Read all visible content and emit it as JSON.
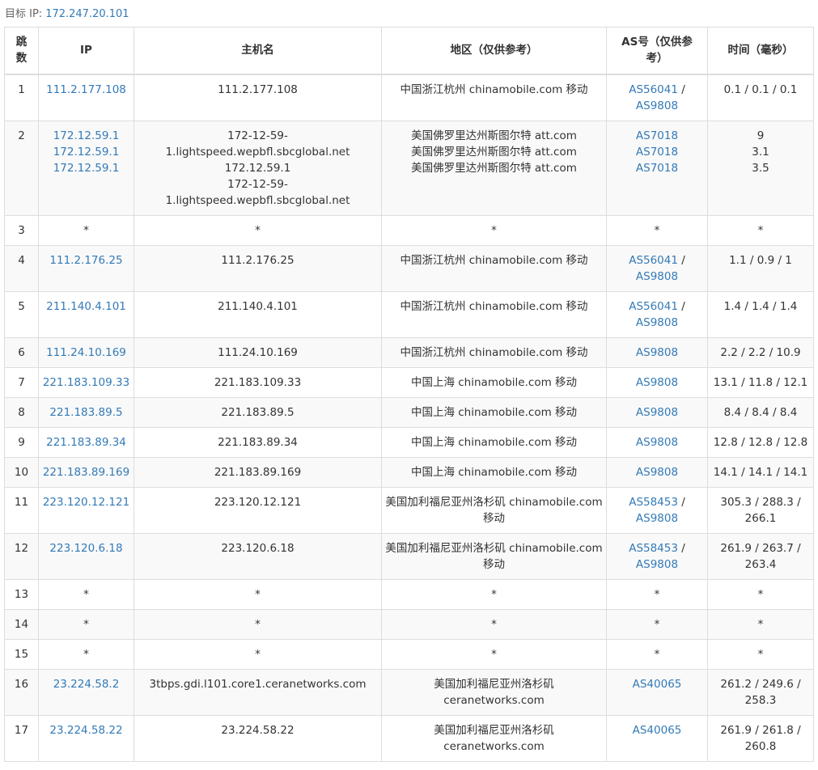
{
  "target": {
    "label": "目标 IP:",
    "ip": "172.247.20.101"
  },
  "colors": {
    "link": "#337ab7",
    "text": "#333333",
    "border": "#dddddd",
    "zebra": "#f9f9f9"
  },
  "table": {
    "headers": {
      "hop": "跳数",
      "ip": "IP",
      "hostname": "主机名",
      "region": "地区（仅供参考）",
      "as": "AS号（仅供参考）",
      "time": "时间（毫秒）"
    },
    "rows": [
      {
        "hop": "1",
        "ips": [
          "111.2.177.108"
        ],
        "hosts": [
          "111.2.177.108"
        ],
        "regions": [
          "中国浙江杭州 chinamobile.com 移动"
        ],
        "as": [
          [
            "AS56041",
            "AS9808"
          ]
        ],
        "times": [
          "0.1 / 0.1 / 0.1"
        ]
      },
      {
        "hop": "2",
        "ips": [
          "172.12.59.1",
          "172.12.59.1",
          "172.12.59.1"
        ],
        "hosts": [
          "172-12-59-1.lightspeed.wepbfl.sbcglobal.net",
          "172.12.59.1",
          "172-12-59-1.lightspeed.wepbfl.sbcglobal.net"
        ],
        "regions": [
          "美国佛罗里达州斯图尔特 att.com",
          "美国佛罗里达州斯图尔特 att.com",
          "美国佛罗里达州斯图尔特 att.com"
        ],
        "as": [
          [
            "AS7018"
          ],
          [
            "AS7018"
          ],
          [
            "AS7018"
          ]
        ],
        "times": [
          "9",
          "3.1",
          "3.5"
        ]
      },
      {
        "hop": "3",
        "ips": [
          "*"
        ],
        "hosts": [
          "*"
        ],
        "regions": [
          "*"
        ],
        "as": [
          [
            "*"
          ]
        ],
        "times": [
          "*"
        ]
      },
      {
        "hop": "4",
        "ips": [
          "111.2.176.25"
        ],
        "hosts": [
          "111.2.176.25"
        ],
        "regions": [
          "中国浙江杭州 chinamobile.com 移动"
        ],
        "as": [
          [
            "AS56041",
            "AS9808"
          ]
        ],
        "times": [
          "1.1 / 0.9 / 1"
        ]
      },
      {
        "hop": "5",
        "ips": [
          "211.140.4.101"
        ],
        "hosts": [
          "211.140.4.101"
        ],
        "regions": [
          "中国浙江杭州 chinamobile.com 移动"
        ],
        "as": [
          [
            "AS56041",
            "AS9808"
          ]
        ],
        "times": [
          "1.4 / 1.4 / 1.4"
        ]
      },
      {
        "hop": "6",
        "ips": [
          "111.24.10.169"
        ],
        "hosts": [
          "111.24.10.169"
        ],
        "regions": [
          "中国浙江杭州 chinamobile.com 移动"
        ],
        "as": [
          [
            "AS9808"
          ]
        ],
        "times": [
          "2.2 / 2.2 / 10.9"
        ]
      },
      {
        "hop": "7",
        "ips": [
          "221.183.109.33"
        ],
        "hosts": [
          "221.183.109.33"
        ],
        "regions": [
          "中国上海 chinamobile.com 移动"
        ],
        "as": [
          [
            "AS9808"
          ]
        ],
        "times": [
          "13.1 / 11.8 / 12.1"
        ]
      },
      {
        "hop": "8",
        "ips": [
          "221.183.89.5"
        ],
        "hosts": [
          "221.183.89.5"
        ],
        "regions": [
          "中国上海 chinamobile.com 移动"
        ],
        "as": [
          [
            "AS9808"
          ]
        ],
        "times": [
          "8.4 / 8.4 / 8.4"
        ]
      },
      {
        "hop": "9",
        "ips": [
          "221.183.89.34"
        ],
        "hosts": [
          "221.183.89.34"
        ],
        "regions": [
          "中国上海 chinamobile.com 移动"
        ],
        "as": [
          [
            "AS9808"
          ]
        ],
        "times": [
          "12.8 / 12.8 / 12.8"
        ]
      },
      {
        "hop": "10",
        "ips": [
          "221.183.89.169"
        ],
        "hosts": [
          "221.183.89.169"
        ],
        "regions": [
          "中国上海 chinamobile.com 移动"
        ],
        "as": [
          [
            "AS9808"
          ]
        ],
        "times": [
          "14.1 / 14.1 / 14.1"
        ]
      },
      {
        "hop": "11",
        "ips": [
          "223.120.12.121"
        ],
        "hosts": [
          "223.120.12.121"
        ],
        "regions": [
          "美国加利福尼亚州洛杉矶 chinamobile.com 移动"
        ],
        "as": [
          [
            "AS58453",
            "AS9808"
          ]
        ],
        "times": [
          "305.3 / 288.3 / 266.1"
        ]
      },
      {
        "hop": "12",
        "ips": [
          "223.120.6.18"
        ],
        "hosts": [
          "223.120.6.18"
        ],
        "regions": [
          "美国加利福尼亚州洛杉矶 chinamobile.com 移动"
        ],
        "as": [
          [
            "AS58453",
            "AS9808"
          ]
        ],
        "times": [
          "261.9 / 263.7 / 263.4"
        ]
      },
      {
        "hop": "13",
        "ips": [
          "*"
        ],
        "hosts": [
          "*"
        ],
        "regions": [
          "*"
        ],
        "as": [
          [
            "*"
          ]
        ],
        "times": [
          "*"
        ]
      },
      {
        "hop": "14",
        "ips": [
          "*"
        ],
        "hosts": [
          "*"
        ],
        "regions": [
          "*"
        ],
        "as": [
          [
            "*"
          ]
        ],
        "times": [
          "*"
        ]
      },
      {
        "hop": "15",
        "ips": [
          "*"
        ],
        "hosts": [
          "*"
        ],
        "regions": [
          "*"
        ],
        "as": [
          [
            "*"
          ]
        ],
        "times": [
          "*"
        ]
      },
      {
        "hop": "16",
        "ips": [
          "23.224.58.2"
        ],
        "hosts": [
          "3tbps.gdi.l101.core1.ceranetworks.com"
        ],
        "regions": [
          "美国加利福尼亚州洛杉矶 ceranetworks.com"
        ],
        "as": [
          [
            "AS40065"
          ]
        ],
        "times": [
          "261.2 / 249.6 / 258.3"
        ]
      },
      {
        "hop": "17",
        "ips": [
          "23.224.58.22"
        ],
        "hosts": [
          "23.224.58.22"
        ],
        "regions": [
          "美国加利福尼亚州洛杉矶 ceranetworks.com"
        ],
        "as": [
          [
            "AS40065"
          ]
        ],
        "times": [
          "261.9 / 261.8 / 260.8"
        ]
      }
    ]
  }
}
